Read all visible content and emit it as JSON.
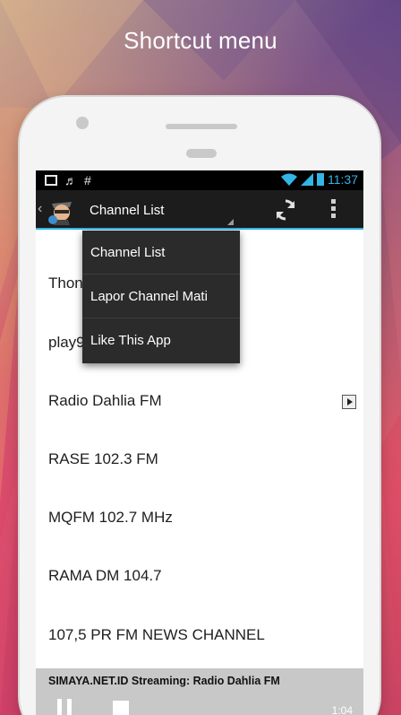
{
  "promo": {
    "title": "Shortcut menu"
  },
  "statusbar": {
    "left_icons": [
      "image-icon",
      "music-note-icon",
      "hash-icon"
    ],
    "hash_glyph": "#",
    "music_glyph": "♬",
    "time": "11:37",
    "accent_color": "#33b5e5"
  },
  "actionbar": {
    "title": "Channel List",
    "back_glyph": "‹"
  },
  "dropdown": {
    "items": [
      {
        "label": "Channel List"
      },
      {
        "label": "Lapor Channel Mati"
      },
      {
        "label": "Like This App"
      }
    ]
  },
  "list": {
    "top_cut_text": "",
    "items": [
      {
        "label": "Thon"
      },
      {
        "label": "play9"
      },
      {
        "label": "Radio Dahlia FM",
        "playing": true
      },
      {
        "label": "RASE 102.3 FM"
      },
      {
        "label": "MQFM 102.7 MHz"
      },
      {
        "label": "RAMA DM 104.7"
      },
      {
        "label": "107,5 PR FM NEWS CHANNEL"
      }
    ]
  },
  "now_playing": {
    "text": "SIMAYA.NET.ID Streaming: Radio Dahlia FM",
    "time": "1:04"
  }
}
